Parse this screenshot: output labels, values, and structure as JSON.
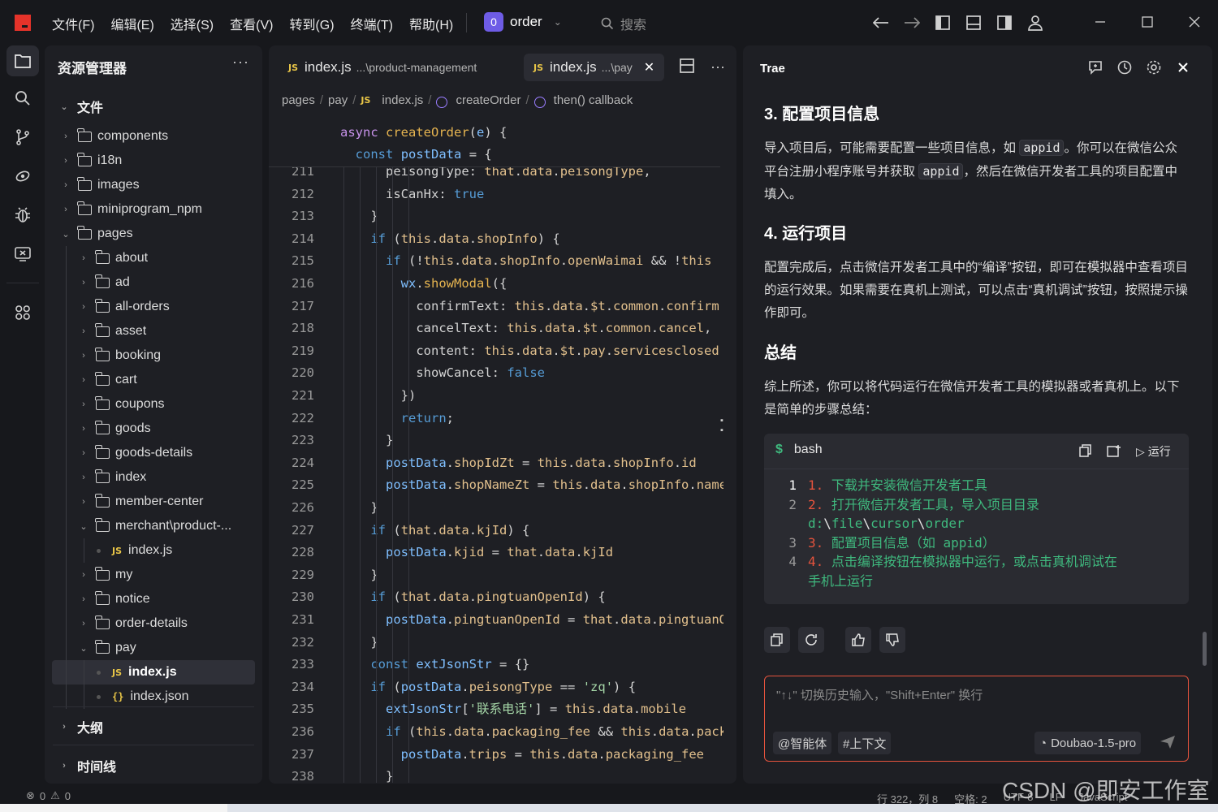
{
  "menu": [
    "文件(F)",
    "编辑(E)",
    "选择(S)",
    "查看(V)",
    "转到(G)",
    "终端(T)",
    "帮助(H)"
  ],
  "project": {
    "badge": "0",
    "name": "order"
  },
  "search_placeholder": "搜索",
  "icons": {
    "top": [
      "arrow-left-icon",
      "arrow-right-icon",
      "toggle-sidebar-left-icon",
      "toggle-panel-icon",
      "toggle-sidebar-right-icon",
      "account-icon"
    ],
    "window": [
      "minimize-icon",
      "maximize-icon",
      "close-icon"
    ],
    "activity": [
      "explorer-icon",
      "search-icon",
      "source-control-icon",
      "remote-icon",
      "debug-icon",
      "preview-icon",
      "extensions-icon"
    ]
  },
  "explorer": {
    "title": "资源管理器",
    "more": "···",
    "section_files": "文件",
    "section_outline": "大纲",
    "section_timeline": "时间线",
    "items": [
      {
        "label": "components",
        "type": "folder",
        "depth": 0,
        "open": false
      },
      {
        "label": "i18n",
        "type": "folder",
        "depth": 0,
        "open": false
      },
      {
        "label": "images",
        "type": "folder",
        "depth": 0,
        "open": false
      },
      {
        "label": "miniprogram_npm",
        "type": "folder",
        "depth": 0,
        "open": false
      },
      {
        "label": "pages",
        "type": "folder",
        "depth": 0,
        "open": true
      },
      {
        "label": "about",
        "type": "folder",
        "depth": 1,
        "open": false
      },
      {
        "label": "ad",
        "type": "folder",
        "depth": 1,
        "open": false
      },
      {
        "label": "all-orders",
        "type": "folder",
        "depth": 1,
        "open": false
      },
      {
        "label": "asset",
        "type": "folder",
        "depth": 1,
        "open": false
      },
      {
        "label": "booking",
        "type": "folder",
        "depth": 1,
        "open": false
      },
      {
        "label": "cart",
        "type": "folder",
        "depth": 1,
        "open": false
      },
      {
        "label": "coupons",
        "type": "folder",
        "depth": 1,
        "open": false
      },
      {
        "label": "goods",
        "type": "folder",
        "depth": 1,
        "open": false
      },
      {
        "label": "goods-details",
        "type": "folder",
        "depth": 1,
        "open": false
      },
      {
        "label": "index",
        "type": "folder",
        "depth": 1,
        "open": false
      },
      {
        "label": "member-center",
        "type": "folder",
        "depth": 1,
        "open": false
      },
      {
        "label": "merchant\\product-...",
        "type": "folder",
        "depth": 1,
        "open": true
      },
      {
        "label": "index.js",
        "type": "js",
        "depth": 2,
        "open": false
      },
      {
        "label": "my",
        "type": "folder",
        "depth": 1,
        "open": false
      },
      {
        "label": "notice",
        "type": "folder",
        "depth": 1,
        "open": false
      },
      {
        "label": "order-details",
        "type": "folder",
        "depth": 1,
        "open": false
      },
      {
        "label": "pay",
        "type": "folder",
        "depth": 1,
        "open": true
      },
      {
        "label": "index.js",
        "type": "js",
        "depth": 2,
        "open": false,
        "selected": true
      },
      {
        "label": "index.json",
        "type": "json",
        "depth": 2,
        "open": false
      }
    ]
  },
  "tabs": [
    {
      "icon": "JS",
      "name": "index.js",
      "path": "...\\product-management",
      "active": false
    },
    {
      "icon": "JS",
      "name": "index.js",
      "path": "...\\pay",
      "active": true,
      "close": "✕"
    }
  ],
  "breadcrumb": [
    "pages",
    "pay",
    "index.js",
    "createOrder",
    "then() callback"
  ],
  "sticky": [
    "async createOrder(e) {",
    "  const postData = {"
  ],
  "code": [
    {
      "n": "211",
      "t": "      peisongType: that.data.peisongType,"
    },
    {
      "n": "212",
      "t": "      isCanHx: true"
    },
    {
      "n": "213",
      "t": "    }"
    },
    {
      "n": "214",
      "t": "    if (this.data.shopInfo) {"
    },
    {
      "n": "215",
      "t": "      if (!this.data.shopInfo.openWaimai && !this"
    },
    {
      "n": "216",
      "t": "        wx.showModal({"
    },
    {
      "n": "217",
      "t": "          confirmText: this.data.$t.common.confirm"
    },
    {
      "n": "218",
      "t": "          cancelText: this.data.$t.common.cancel,"
    },
    {
      "n": "219",
      "t": "          content: this.data.$t.pay.servicesclosed"
    },
    {
      "n": "220",
      "t": "          showCancel: false"
    },
    {
      "n": "221",
      "t": "        })"
    },
    {
      "n": "222",
      "t": "        return;"
    },
    {
      "n": "223",
      "t": "      }"
    },
    {
      "n": "224",
      "t": "      postData.shopIdZt = this.data.shopInfo.id"
    },
    {
      "n": "225",
      "t": "      postData.shopNameZt = this.data.shopInfo.name"
    },
    {
      "n": "226",
      "t": "    }"
    },
    {
      "n": "227",
      "t": "    if (that.data.kjId) {"
    },
    {
      "n": "228",
      "t": "      postData.kjid = that.data.kjId"
    },
    {
      "n": "229",
      "t": "    }"
    },
    {
      "n": "230",
      "t": "    if (that.data.pingtuanOpenId) {"
    },
    {
      "n": "231",
      "t": "      postData.pingtuanOpenId = that.data.pingtuanOpenId"
    },
    {
      "n": "232",
      "t": "    }"
    },
    {
      "n": "233",
      "t": "    const extJsonStr = {}"
    },
    {
      "n": "234",
      "t": "    if (postData.peisongType == 'zq') {"
    },
    {
      "n": "235",
      "t": "      extJsonStr['联系电话'] = this.data.mobile"
    },
    {
      "n": "236",
      "t": "      if (this.data.packaging_fee && this.data.packaging_fee"
    },
    {
      "n": "237",
      "t": "        postData.trips = this.data.packaging_fee"
    },
    {
      "n": "238",
      "t": "      }"
    }
  ],
  "chat": {
    "title": "Trae",
    "icons": [
      "new-chat-icon",
      "history-icon",
      "settings-icon",
      "close-icon"
    ],
    "h_config": "3. 配置项目信息",
    "p_config_1": "导入项目后，可能需要配置一些项目信息，如",
    "p_config_code1": "appid",
    "p_config_2": "。你可以在微信公众平台注册小程序账号并获取",
    "p_config_code2": "appid",
    "p_config_3": "，然后在微信开发者工具的项目配置中填入。",
    "h_run": "4. 运行项目",
    "p_run": "配置完成后，点击微信开发者工具中的“编译”按钮，即可在模拟器中查看项目的运行效果。如果需要在真机上测试，可以点击“真机调试”按钮，按照提示操作即可。",
    "h_summary": "总结",
    "p_summary": "综上所述，你可以将代码运行在微信开发者工具的模拟器或者真机上。以下是简单的步骤总结：",
    "codeblock": {
      "prompt": "$",
      "lang": "bash",
      "run": "运行",
      "lines": [
        {
          "n": "1",
          "num": "1.",
          "text": " 下载并安装微信开发者工具"
        },
        {
          "n": "2",
          "num": "2.",
          "text": " 打开微信开发者工具，导入项目目录"
        },
        {
          "n": "",
          "num": "",
          "text": "d:\\file\\cursor\\order"
        },
        {
          "n": "3",
          "num": "3.",
          "text": " 配置项目信息（如 appid）"
        },
        {
          "n": "4",
          "num": "4.",
          "text": " 点击编译按钮在模拟器中运行，或点击真机调试在"
        },
        {
          "n": "",
          "num": "",
          "text": "手机上运行"
        }
      ]
    },
    "feedback": [
      "copy-icon",
      "refresh-icon",
      "thumbs-up-icon",
      "thumbs-down-icon"
    ],
    "input_placeholder": "\"↑↓\" 切换历史输入，\"Shift+Enter\" 换行",
    "chip_agent": "@智能体",
    "chip_context": "#上下文",
    "model": "Doubao-1.5-pro"
  },
  "status": {
    "errors": "0",
    "warnings": "0",
    "position": "行 322，列 8",
    "spaces": "空格: 2",
    "encoding": "UTF-8",
    "eol": "LF",
    "language": "JavaScript"
  },
  "watermark": "CSDN @即安工作室",
  "colors": {
    "accent": "#6e5ce6",
    "logo": "#e5332a",
    "input_border": "#e5533d",
    "bash_green": "#3fb97e"
  }
}
